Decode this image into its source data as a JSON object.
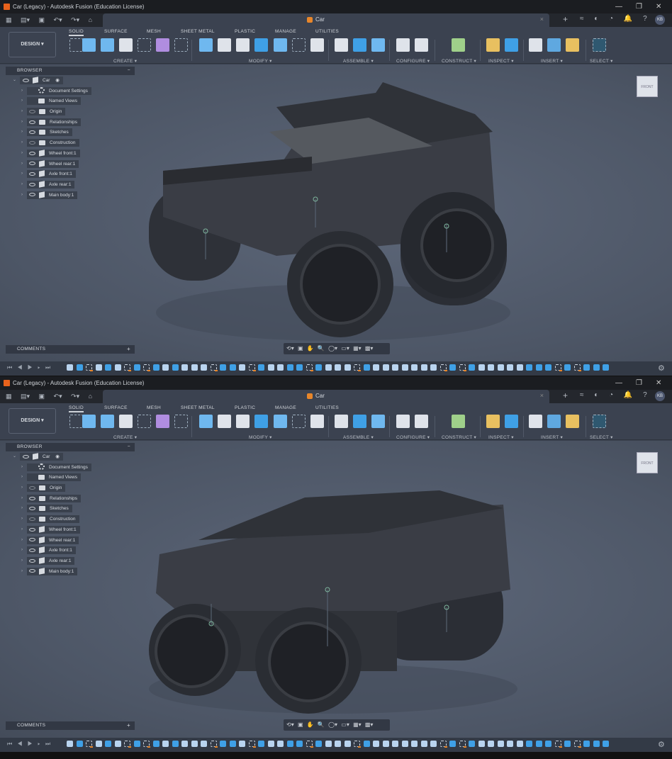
{
  "window": {
    "title": "Car (Legacy) - Autodesk Fusion (Education License)",
    "controls": {
      "minimize": "—",
      "restore": "❐",
      "close": "✕"
    }
  },
  "qat": {
    "icons": [
      "grid-icon",
      "file-icon",
      "save-icon",
      "undo-icon",
      "redo-icon",
      "home-icon"
    ],
    "glyphs": "▦ ▤▾ ▣ ↶▾ ↷▾ ⌂"
  },
  "document_tab": {
    "label": "Car",
    "close": "×",
    "new_tab": "+"
  },
  "header_icons": {
    "glyphs": "≈ ◐ ◔ 🔔 ?"
  },
  "user": {
    "initials": "KB"
  },
  "design_button": "DESIGN ▾",
  "workspace_tabs": [
    "SOLID",
    "SURFACE",
    "MESH",
    "SHEET METAL",
    "PLASTIC",
    "MANAGE",
    "UTILITIES"
  ],
  "active_tab": "SOLID",
  "tool_groups": [
    "CREATE ▾",
    "MODIFY ▾",
    "ASSEMBLE ▾",
    "CONFIGURE ▾",
    "CONSTRUCT ▾",
    "INSPECT ▾",
    "INSERT ▾",
    "SELECT ▾"
  ],
  "browser": {
    "title": "BROWSER",
    "collapse": "−",
    "root": "Car",
    "items": [
      {
        "label": "Document Settings",
        "icon": "gear",
        "eye": "none"
      },
      {
        "label": "Named Views",
        "icon": "folder",
        "eye": "none"
      },
      {
        "label": "Origin",
        "icon": "folder",
        "eye": "off"
      },
      {
        "label": "Relationships",
        "icon": "folder",
        "eye": "on"
      },
      {
        "label": "Sketches",
        "icon": "folder",
        "eye": "on"
      },
      {
        "label": "Construction",
        "icon": "folder",
        "eye": "off"
      },
      {
        "label": "Wheel front:1",
        "icon": "component",
        "eye": "on"
      },
      {
        "label": "Wheel rear:1",
        "icon": "component",
        "eye": "on"
      },
      {
        "label": "Axle front:1",
        "icon": "component",
        "eye": "on"
      },
      {
        "label": "Axle rear:1",
        "icon": "component",
        "eye": "on"
      },
      {
        "label": "Main body:1",
        "icon": "component",
        "eye": "on"
      }
    ]
  },
  "comments": {
    "title": "COMMENTS",
    "add": "+"
  },
  "nav_bar": {
    "glyphs": "⟲▾ ▣ ✋ 🔍 ◯▾ ▭▾ ▦▾ ▩▾"
  },
  "timeline": {
    "controls": "⏮ ◀ ▶ ▸ ⏭",
    "settings": "⚙",
    "features": "fbskbfsbsbkbfffsbbfsbffbbsbfffsbfffkfffsbsbffffxbbbsbsbbb"
  },
  "colors": {
    "accent": "#e8862a",
    "tool_blue": "#3fa0e6",
    "bg": "#3b4250"
  }
}
